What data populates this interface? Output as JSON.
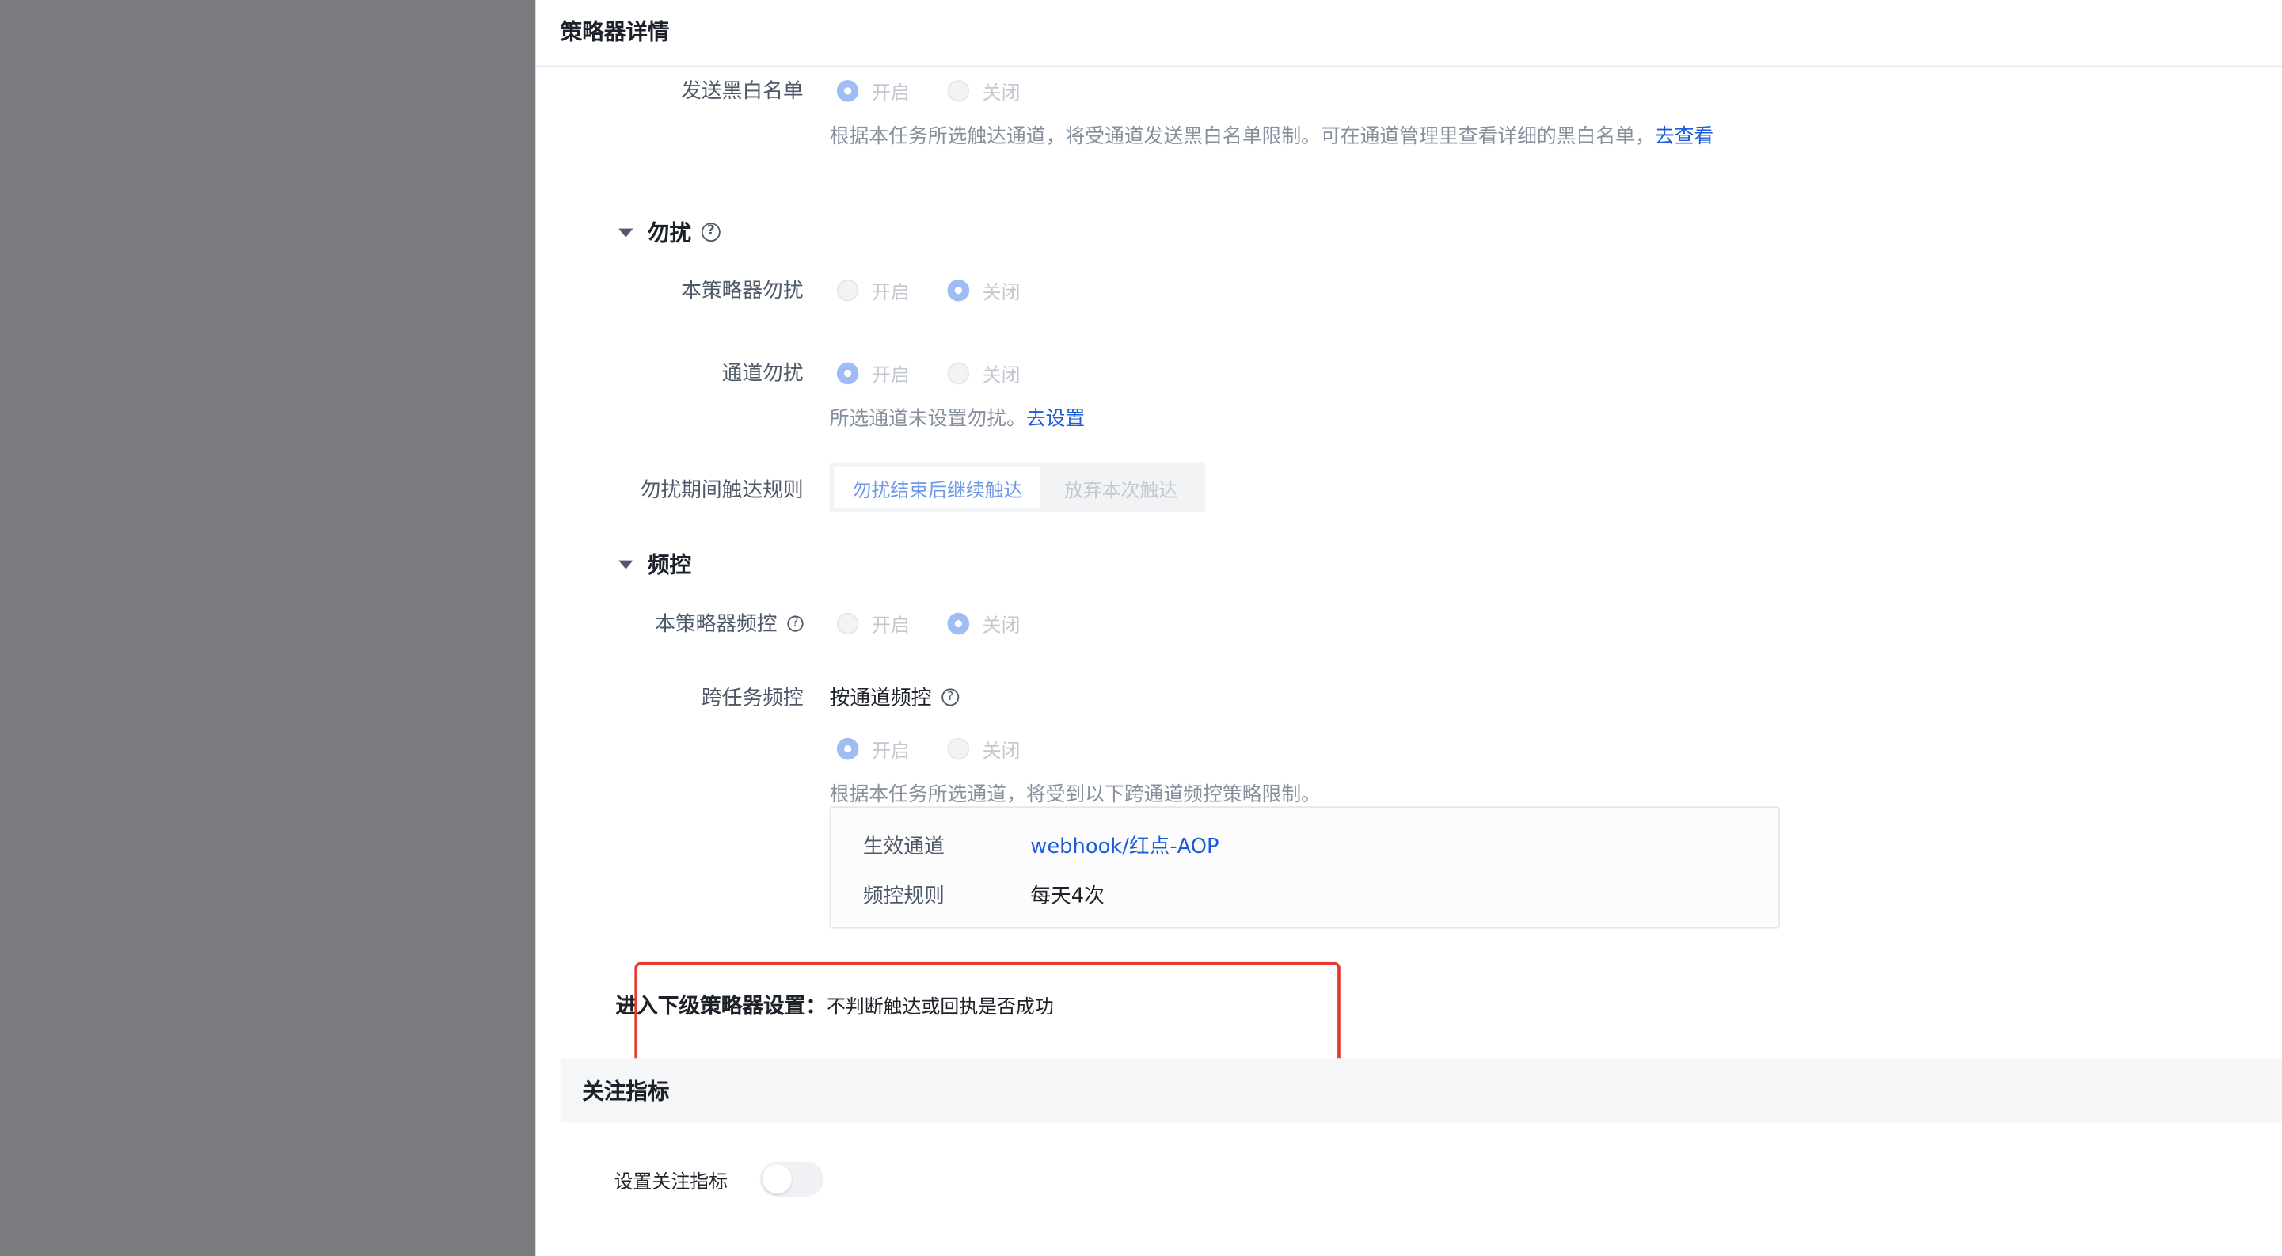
{
  "drawer": {
    "title": "策略器详情"
  },
  "blacklist": {
    "label": "发送黑白名单",
    "opt_on": "开启",
    "opt_off": "关闭",
    "selected": "开启",
    "hint": "根据本任务所选触达通道，将受通道发送黑白名单限制。可在通道管理里查看详细的黑白名单，",
    "link": "去查看"
  },
  "dnd": {
    "section_title": "勿扰",
    "help_icon": "question-circle-icon",
    "strategy_label": "本策略器勿扰",
    "strategy_selected": "关闭",
    "channel_label": "通道勿扰",
    "channel_selected": "开启",
    "channel_hint": "所选通道未设置勿扰。",
    "channel_link": "去设置",
    "rule_label": "勿扰期间触达规则",
    "rule_options": [
      "勿扰结束后继续触达",
      "放弃本次触达"
    ],
    "rule_selected": "勿扰结束后继续触达",
    "opt_on": "开启",
    "opt_off": "关闭"
  },
  "freq": {
    "section_title": "频控",
    "strategy_label": "本策略器频控",
    "strategy_selected": "关闭",
    "cross_label": "跨任务频控",
    "by_channel_label": "按通道频控",
    "cross_selected": "开启",
    "hint": "根据本任务所选通道，将受到以下跨通道频控策略限制。",
    "opt_on": "开启",
    "opt_off": "关闭",
    "effective_channel_key": "生效通道",
    "effective_channel_value": "webhook/红点-AOP",
    "rule_key": "频控规则",
    "rule_value": "每天4次"
  },
  "next_level": {
    "label": "进入下级策略器设置：",
    "value": "不判断触达或回执是否成功"
  },
  "metrics": {
    "section_title": "关注指标",
    "setting_label": "设置关注指标",
    "toggle_on": false
  },
  "colors": {
    "overlay": "#7b7c80",
    "link": "#1c5cd9",
    "highlight_border": "#e33b2e",
    "radio_checked": "#9fbcf5"
  }
}
